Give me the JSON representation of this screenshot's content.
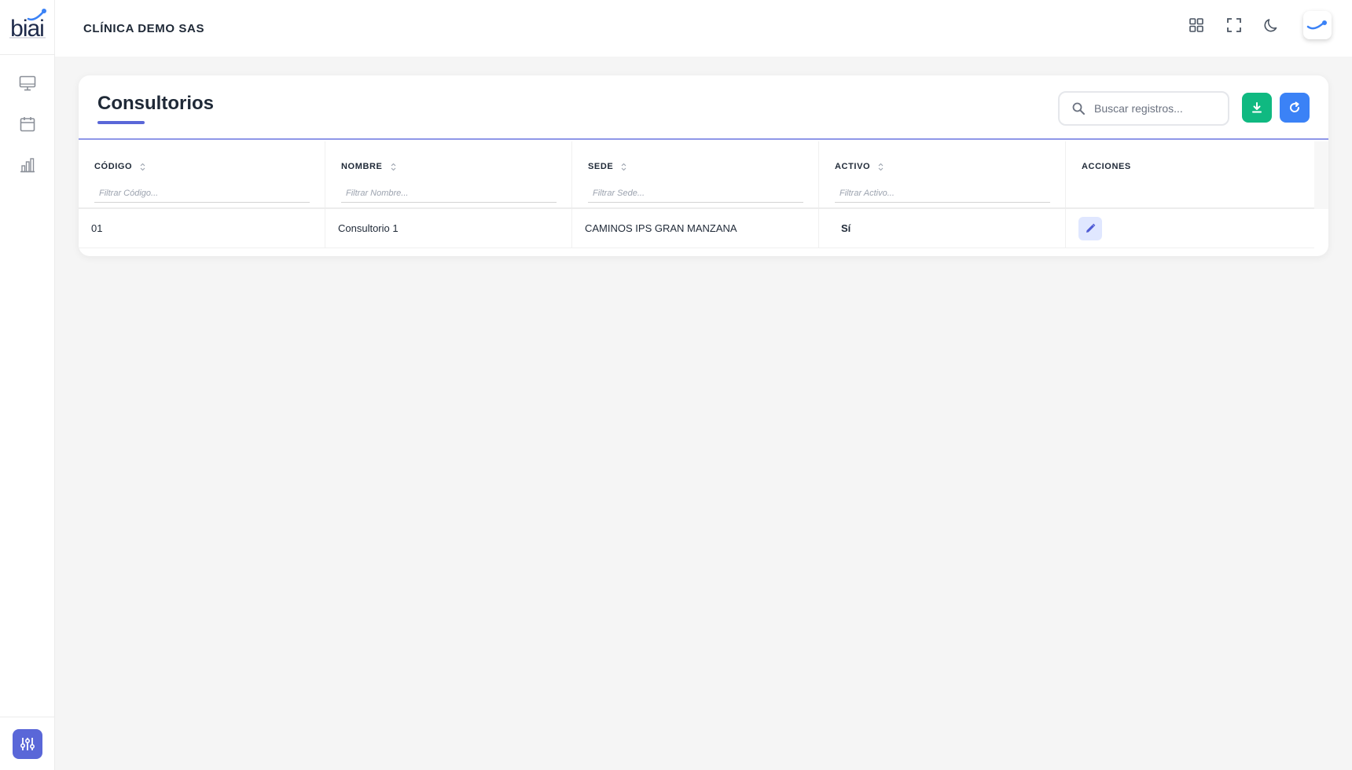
{
  "sidebar": {
    "logo_text": "biai",
    "nav": [
      {
        "icon": "monitor-icon"
      },
      {
        "icon": "calendar-icon"
      },
      {
        "icon": "bar-chart-icon"
      }
    ],
    "footer_icon": "sliders-icon"
  },
  "header": {
    "org_name": "CLÍNICA DEMO SAS",
    "icons": [
      "grid-icon",
      "fullscreen-icon",
      "moon-icon",
      "avatar"
    ]
  },
  "card": {
    "title": "Consultorios",
    "search_placeholder": "Buscar registros...",
    "accent": "#5a67d8",
    "download_color": "#10b981",
    "refresh_color": "#3b82f6"
  },
  "table": {
    "columns": [
      {
        "label": "CÓDIGO",
        "filter_placeholder": "Filtrar Código..."
      },
      {
        "label": "NOMBRE",
        "filter_placeholder": "Filtrar Nombre..."
      },
      {
        "label": "SEDE",
        "filter_placeholder": "Filtrar Sede..."
      },
      {
        "label": "ACTIVO",
        "filter_placeholder": "Filtrar Activo..."
      },
      {
        "label": "ACCIONES"
      }
    ],
    "rows": [
      {
        "codigo": "01",
        "nombre": "Consultorio 1",
        "sede": "CAMINOS IPS GRAN MANZANA",
        "activo": "Sí"
      }
    ]
  }
}
